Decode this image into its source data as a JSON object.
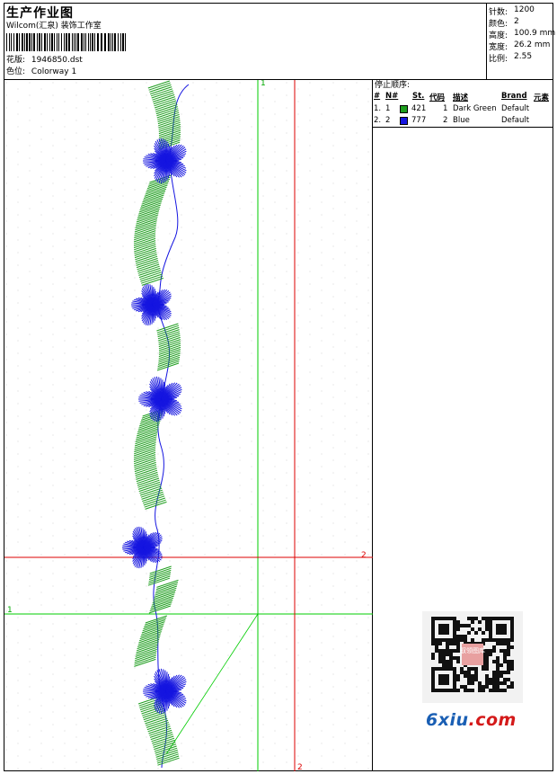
{
  "header": {
    "title": "生产作业图",
    "studio": "Wilcom(汇泉) 装饰工作室",
    "design_label": "花版:",
    "design_value": "1946850.dst",
    "colorway_label": "色位:",
    "colorway_value": "Colorway 1"
  },
  "stats": [
    {
      "label": "针数:",
      "value": "1200"
    },
    {
      "label": "颜色:",
      "value": "2"
    },
    {
      "label": "高度:",
      "value": "100.9 mm"
    },
    {
      "label": "宽度:",
      "value": "26.2 mm"
    },
    {
      "label": "比例:",
      "value": "2.55"
    }
  ],
  "stop_sequence": {
    "title": "停止顺序:",
    "columns": [
      "#",
      "N#",
      "St.",
      "代码",
      "描述",
      "Brand",
      "元素"
    ],
    "rows": [
      {
        "idx": "1.",
        "n": "1",
        "color": "#1e9e1e",
        "st": "421",
        "code": "1",
        "desc": "Dark Green",
        "brand": "Default"
      },
      {
        "idx": "2.",
        "n": "2",
        "color": "#1515e0",
        "st": "777",
        "code": "2",
        "desc": "Blue",
        "brand": "Default"
      }
    ]
  },
  "guides": {
    "green_top": "1",
    "green_left": "1",
    "red_right": "2",
    "red_bottom": "2",
    "green_color": "#00cc00",
    "red_color": "#dd0000"
  },
  "thread_colors": {
    "dark_green": "#1e9e1e",
    "blue": "#1515e0"
  },
  "watermark": {
    "main": "6xiu",
    "suffix": ".com",
    "qr_text": "驭领图库"
  }
}
